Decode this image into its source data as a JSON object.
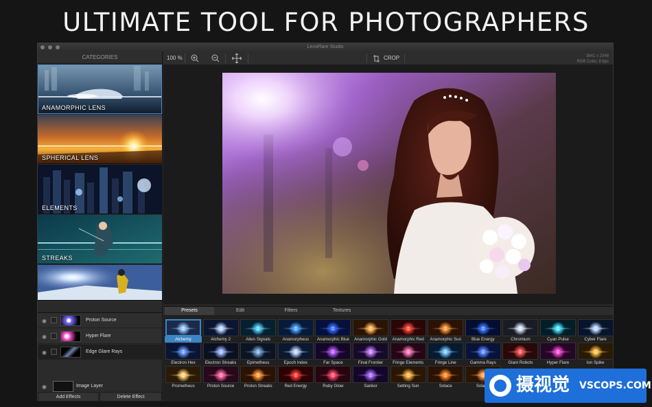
{
  "headline": "ULTIMATE TOOL FOR PHOTOGRAPHERS",
  "window": {
    "title": "LensFlare Studio"
  },
  "sidebar": {
    "header": "CATEGORIES",
    "categories": [
      {
        "label": "ANAMORPHIC LENS",
        "selected": true
      },
      {
        "label": "SPHERICAL LENS"
      },
      {
        "label": "ELEMENTS"
      },
      {
        "label": "STREAKS"
      },
      {
        "label": ""
      }
    ]
  },
  "layers": {
    "items": [
      {
        "name": "Proton Source"
      },
      {
        "name": "Hyper Flare"
      },
      {
        "name": "Edge Glare Rays",
        "selected": true
      }
    ],
    "image_layer": "Image Layer",
    "add_button": "Add Effects",
    "delete_button": "Delete Effect"
  },
  "toolbar": {
    "zoom": "100 %",
    "crop": "CROP",
    "image_size": "3841 x 2048",
    "image_mode": "RGB Color, 8 bpc"
  },
  "panel": {
    "tabs": [
      "Presets",
      "Edit",
      "Filters",
      "Textures"
    ],
    "active_tab": "Presets",
    "presets": [
      "Alchemy",
      "Alchemy 2",
      "Alien Signals",
      "Anamorpheus",
      "Anamorphic Blue",
      "Anamorphic Gold",
      "Anamorphic Red",
      "Anamorphic Sun",
      "Blue Energy",
      "Chromium",
      "Cyan Pulse",
      "Cyber Flare",
      "Electron Hex",
      "Electron Streaks",
      "Epimetheus",
      "Epoch Index",
      "Far Space",
      "Final Frontier",
      "Fringe Elements",
      "Fringe Line",
      "Gamma Rays",
      "Giant Robots",
      "Hyper Flare",
      "Ion Spike",
      "Prometheus",
      "Proton Source",
      "Proton Streaks",
      "Red Energy",
      "Ruby Glow",
      "Sankor",
      "Setting Sun",
      "Solace",
      "Solar A"
    ],
    "selected_preset": "Alchemy"
  },
  "watermark": {
    "text": "摄视觉",
    "site": "VSCOPS.COM"
  },
  "colors": {
    "accent": "#3b86c5",
    "window_bg": "#262626"
  }
}
